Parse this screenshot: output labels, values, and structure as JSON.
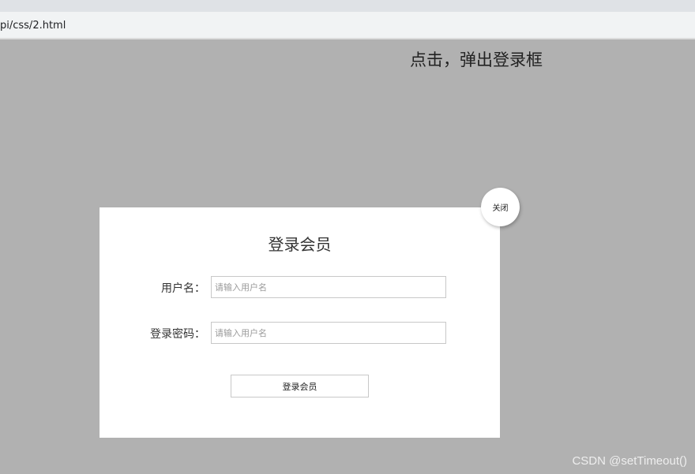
{
  "browser": {
    "address_url": "pi/css/2.html"
  },
  "page": {
    "trigger_text": "点击，弹出登录框",
    "modal": {
      "title": "登录会员",
      "username_label": "用户名：",
      "username_placeholder": "请输入用户名",
      "password_label": "登录密码：",
      "password_placeholder": "请输入用户名",
      "submit_label": "登录会员",
      "close_label": "关闭"
    },
    "watermark": "CSDN @setTimeout()"
  },
  "colors": {
    "overlay_background": "#b1b1b1",
    "modal_background": "#ffffff",
    "input_border": "#c8c8c8"
  }
}
